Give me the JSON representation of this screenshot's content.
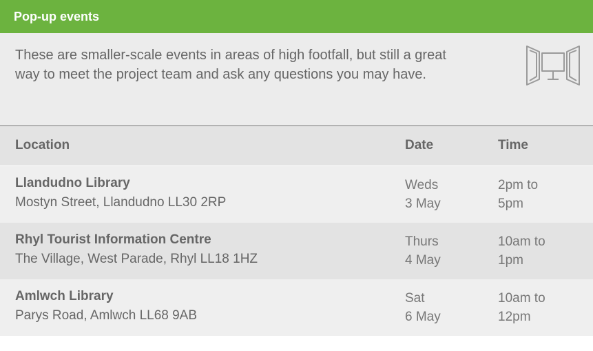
{
  "header": {
    "title": "Pop-up events"
  },
  "intro": {
    "text": "These are smaller-scale events in areas of high footfall, but still a great way to meet the project team and ask any questions you may have.",
    "icon": "exhibition-stand-icon"
  },
  "table": {
    "columns": [
      "Location",
      "Date",
      "Time"
    ],
    "rows": [
      {
        "name": "Llandudno Library",
        "address": "Mostyn Street, Llandudno LL30 2RP",
        "date_day": "Weds",
        "date_month": "3 May",
        "time_start": "2pm to",
        "time_end": "5pm"
      },
      {
        "name": "Rhyl Tourist Information Centre",
        "address": "The Village, West Parade, Rhyl LL18 1HZ",
        "date_day": "Thurs",
        "date_month": "4 May",
        "time_start": "10am to",
        "time_end": "1pm"
      },
      {
        "name": "Amlwch Library",
        "address": "Parys Road, Amlwch LL68 9AB",
        "date_day": "Sat",
        "date_month": "6 May",
        "time_start": "10am to",
        "time_end": "12pm"
      }
    ]
  },
  "colors": {
    "header_bg": "#6cb33f",
    "header_text": "#ffffff",
    "panel_bg": "#ececec",
    "row_alt_bg": "#e3e3e3",
    "text": "#666666"
  }
}
